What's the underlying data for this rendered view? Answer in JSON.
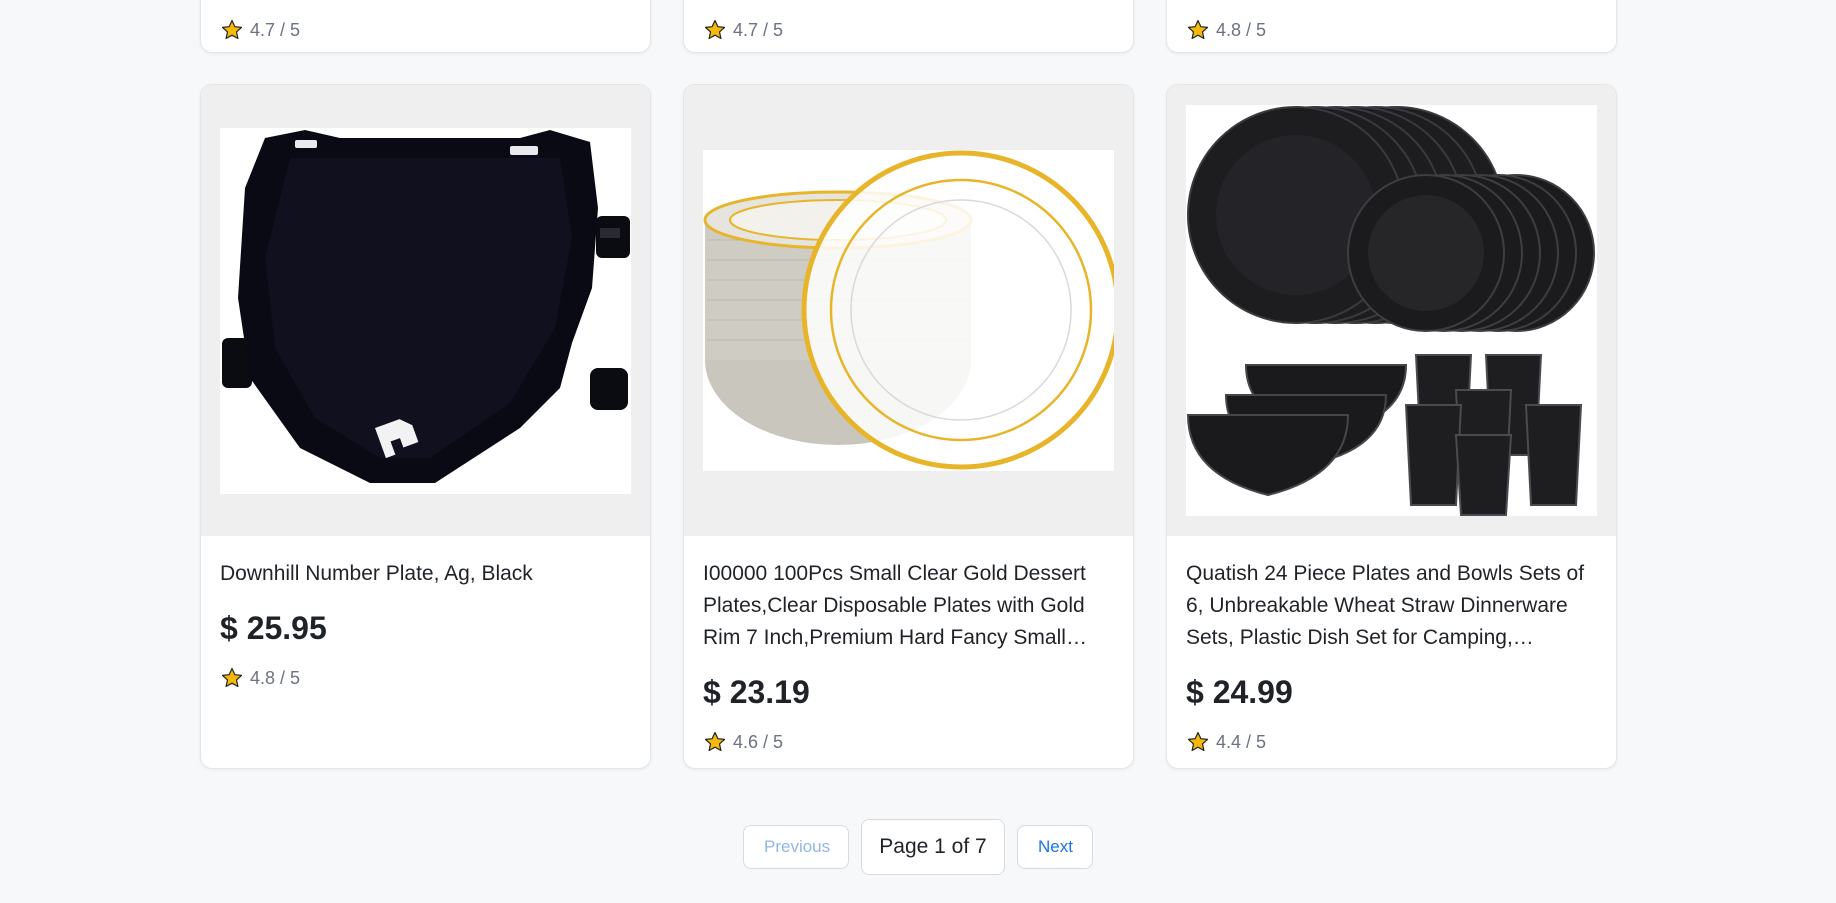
{
  "top_row": [
    {
      "rating": "4.7 / 5"
    },
    {
      "rating": "4.7 / 5"
    },
    {
      "rating": "4.8 / 5"
    }
  ],
  "products": [
    {
      "title": "Downhill Number Plate, Ag, Black",
      "price": "$ 25.95",
      "rating": "4.8 / 5",
      "image": "black-number-plate"
    },
    {
      "title": "I00000 100Pcs Small Clear Gold Dessert Plates,Clear Disposable Plates with Gold Rim 7 Inch,Premium Hard Fancy Small Plates",
      "price": "$ 23.19",
      "rating": "4.6 / 5",
      "image": "clear-gold-plates"
    },
    {
      "title": "Quatish 24 Piece Plates and Bowls Sets of 6, Unbreakable Wheat Straw Dinnerware Sets, Plastic Dish Set for Camping, Microwave Safe",
      "price": "$ 24.99",
      "rating": "4.4 / 5",
      "image": "black-dinnerware-set"
    }
  ],
  "pagination": {
    "previous_label": "Previous",
    "page_indicator": "Page 1 of 7",
    "next_label": "Next"
  },
  "icons": {
    "rating": "star-icon"
  },
  "colors": {
    "star_fill": "#f5b90c",
    "next_link": "#1a73e8",
    "previous_disabled": "#8fb8ea",
    "plate_rim_gold": "#e8b52a"
  }
}
